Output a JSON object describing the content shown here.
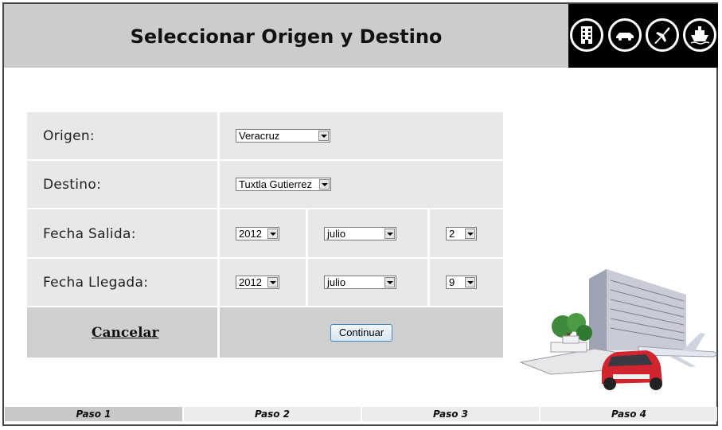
{
  "header": {
    "title": "Seleccionar Origen y Destino",
    "icons": [
      "hotel-icon",
      "car-icon",
      "airplane-icon",
      "ship-icon"
    ]
  },
  "form": {
    "origen": {
      "label": "Origen:",
      "value": "Veracruz"
    },
    "destino": {
      "label": "Destino:",
      "value": "Tuxtla Gutierrez"
    },
    "fecha_salida": {
      "label": "Fecha Salida:",
      "year": "2012",
      "month": "julio",
      "day": "2"
    },
    "fecha_llegada": {
      "label": "Fecha Llegada:",
      "year": "2012",
      "month": "julio",
      "day": "9"
    },
    "cancel_label": "Cancelar",
    "continue_label": "Continuar"
  },
  "steps": [
    {
      "label": "Paso 1",
      "active": true
    },
    {
      "label": "Paso 2",
      "active": false
    },
    {
      "label": "Paso 3",
      "active": false
    },
    {
      "label": "Paso 4",
      "active": false
    }
  ],
  "colors": {
    "header_bg": "#cccccc",
    "cell_bg": "#e8e8e8",
    "footer_row_bg": "#cfcfcf",
    "icon_strip_bg": "#000000"
  }
}
